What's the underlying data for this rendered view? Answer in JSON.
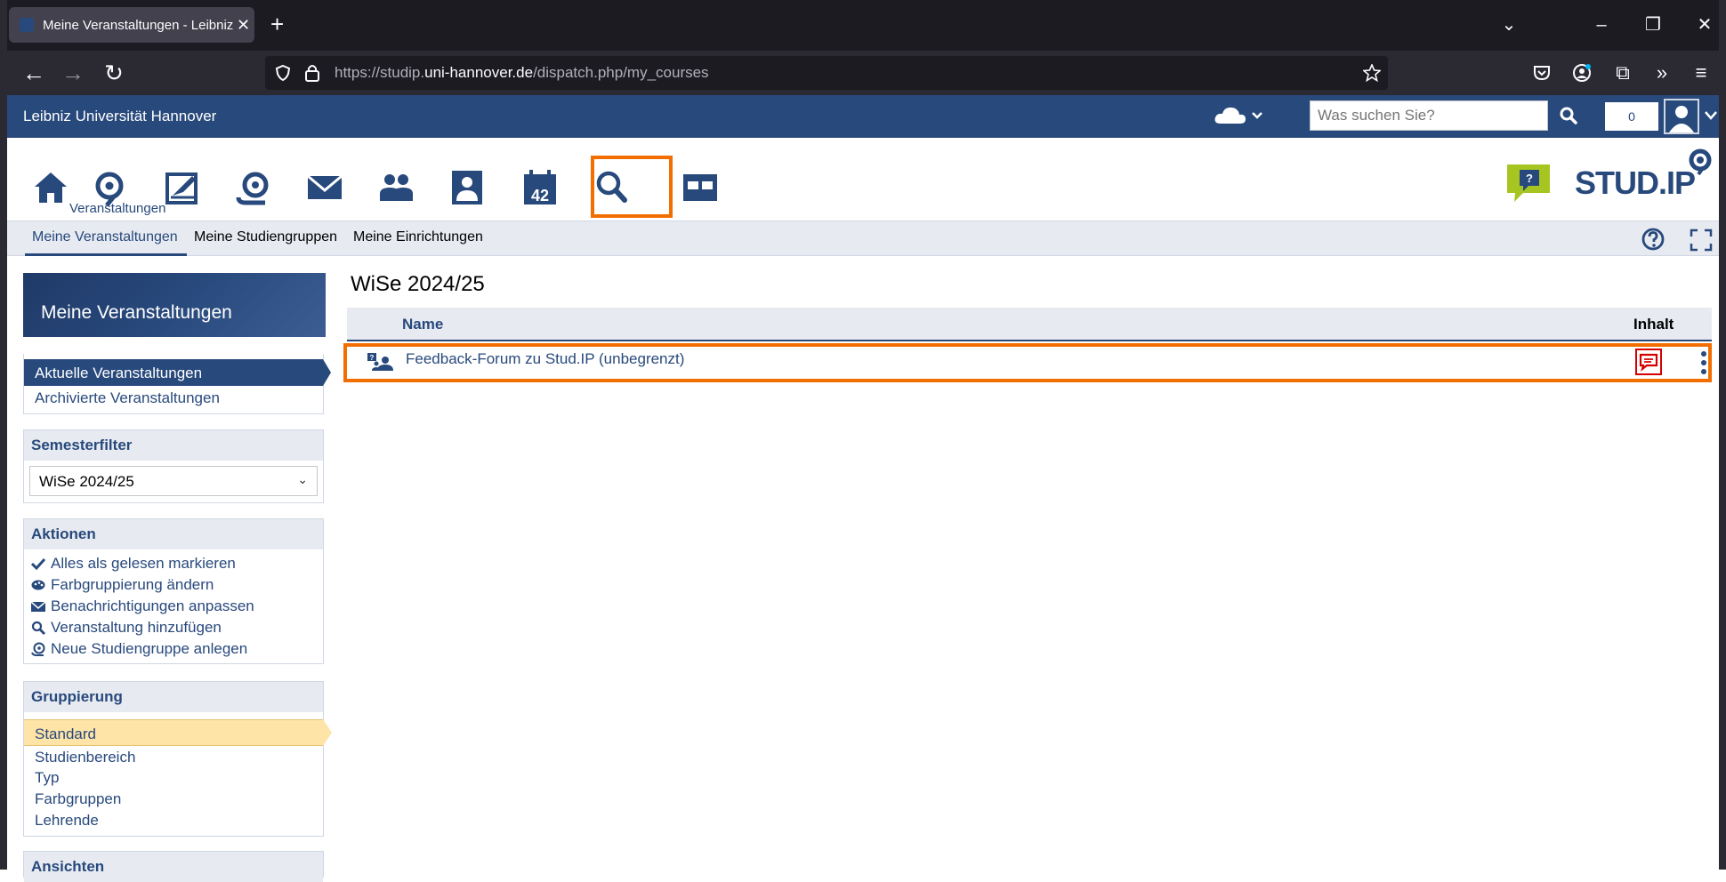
{
  "browser": {
    "tab_title": "Meine Veranstaltungen - Leibniz",
    "url_prefix": "https://studip.",
    "url_domain": "uni-hannover.de",
    "url_path": "/dispatch.php/my_courses"
  },
  "topbar": {
    "org_name": "Leibniz Universität Hannover",
    "search_placeholder": "Was suchen Sie?",
    "notification_count": "0"
  },
  "mainnav": {
    "active_label": "Veranstaltungen",
    "icons": [
      "home-icon",
      "courses-icon",
      "workplace-icon",
      "community-icon",
      "messages-icon",
      "contacts-icon",
      "profile-icon",
      "calendar-icon",
      "search-icon",
      "tools-icon"
    ],
    "calendar_day": "42",
    "logo_text": "STUD.IP"
  },
  "tabs": [
    "Meine Veranstaltungen",
    "Meine Studiengruppen",
    "Meine Einrichtungen"
  ],
  "sidebar": {
    "header": "Meine Veranstaltungen",
    "views": [
      "Aktuelle Veranstaltungen",
      "Archivierte Veranstaltungen"
    ],
    "semesterfilter": {
      "title": "Semesterfilter",
      "selected": "WiSe 2024/25"
    },
    "actions": {
      "title": "Aktionen",
      "items": [
        "Alles als gelesen markieren",
        "Farbgruppierung ändern",
        "Benachrichtigungen anpassen",
        "Veranstaltung hinzufügen",
        "Neue Studiengruppe anlegen"
      ]
    },
    "grouping": {
      "title": "Gruppierung",
      "items": [
        "Standard",
        "Studienbereich",
        "Typ",
        "Farbgruppen",
        "Lehrende"
      ]
    },
    "views_title": "Ansichten"
  },
  "content": {
    "semester": "WiSe 2024/25",
    "col_name": "Name",
    "col_inhalt": "Inhalt",
    "rows": [
      {
        "name": "Feedback-Forum zu Stud.IP (unbegrenzt)"
      }
    ]
  },
  "colors": {
    "brand": "#28497c",
    "highlight": "#f26e00"
  }
}
